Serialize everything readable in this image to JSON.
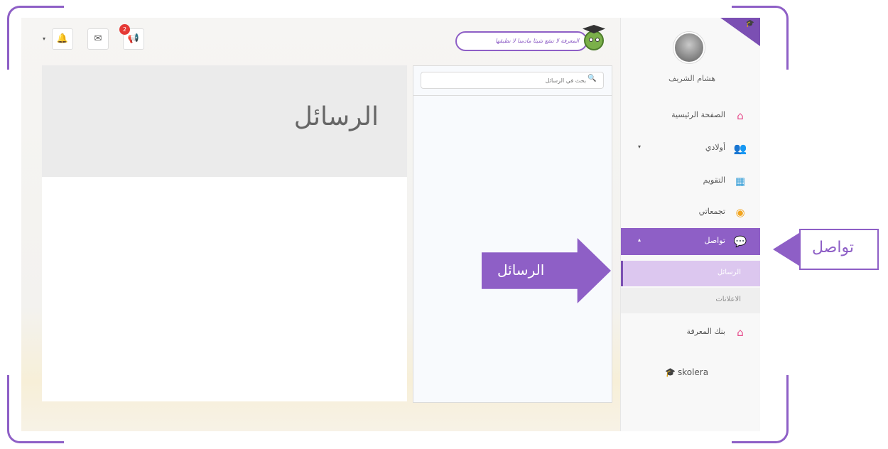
{
  "topbar": {
    "tip_text": "المعرفة لا تنفع شيئا مادمنا لا نطبقها",
    "announcements_badge": "2",
    "dropdown_caret": "▾"
  },
  "sidebar": {
    "username": "هشام الشريف",
    "items": [
      {
        "label": "الصفحة الرئيسية",
        "icon": "home-icon"
      },
      {
        "label": "أولادي",
        "icon": "children-icon",
        "caret": "▾"
      },
      {
        "label": "التقويم",
        "icon": "calendar-icon"
      },
      {
        "label": "تجمعاتي",
        "icon": "groups-icon"
      },
      {
        "label": "تواصل",
        "icon": "chat-bubble-icon",
        "caret": "▴"
      },
      {
        "label": "بنك المعرفة",
        "icon": "knowledge-bank-icon"
      }
    ],
    "sub_items": [
      {
        "label": "الرسائل"
      },
      {
        "label": "الاعلانات"
      }
    ],
    "brand": "skolera"
  },
  "search": {
    "placeholder": "بحث في الرسائل"
  },
  "messages": {
    "title": "الرسائل"
  },
  "callouts": {
    "communication": "تواصل",
    "messages": "الرسائل"
  },
  "colors": {
    "accent": "#8e5fc6",
    "accent_light": "#dcc7ef",
    "badge": "#e53935"
  }
}
